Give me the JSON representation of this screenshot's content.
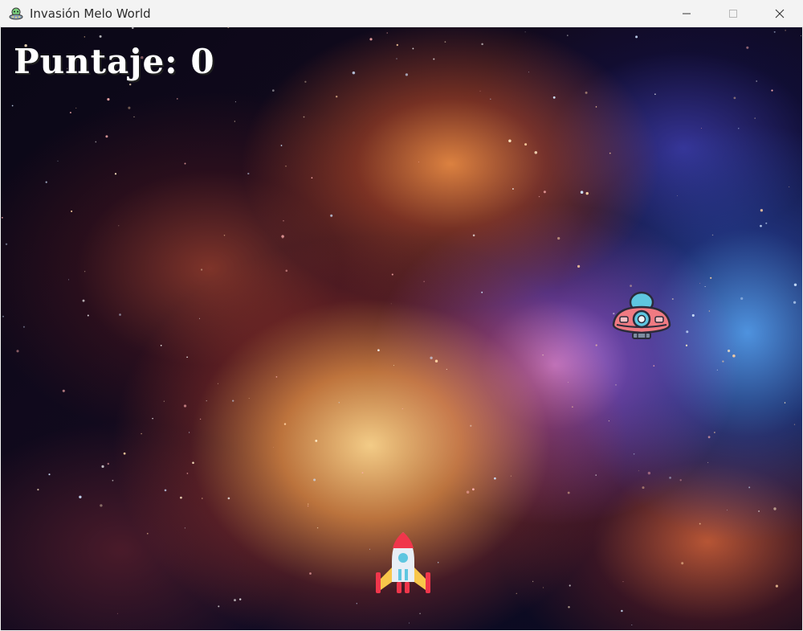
{
  "window": {
    "title": "Invasión Melo World",
    "icon": "alien-ufo-icon",
    "controls": [
      "minimize-icon",
      "maximize-icon",
      "close-icon"
    ]
  },
  "hud": {
    "score_label": "Puntaje: 0",
    "score_value": 0
  },
  "sprites": {
    "player": "rocket-icon",
    "enemy": "ufo-icon"
  },
  "colors": {
    "titlebar_bg": "#f3f3f3",
    "score_text": "#ffffff",
    "rocket_body": "#e8eef5",
    "rocket_accent": "#f0364b",
    "ufo_body": "#f07a82",
    "ufo_dome": "#5ec6e0"
  }
}
